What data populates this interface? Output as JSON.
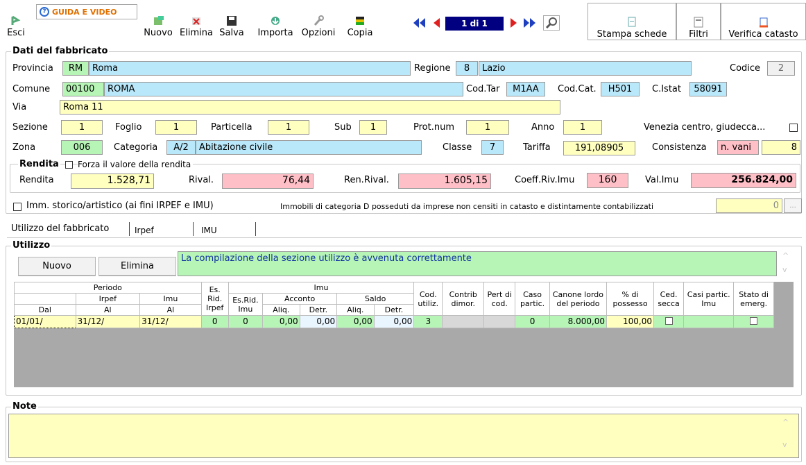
{
  "toolbar": {
    "exit": "Esci",
    "guide": "GUIDA E VIDEO",
    "new": "Nuovo",
    "delete": "Elimina",
    "save": "Salva",
    "import": "Importa",
    "options": "Opzioni",
    "copy": "Copia",
    "record_nav": "1 di 1",
    "print": "Stampa schede",
    "filters": "Filtri",
    "verify": "Verifica catasto"
  },
  "section_title": "Dati del fabbricato",
  "fields": {
    "provincia_label": "Provincia",
    "provincia_code": "RM",
    "provincia_name": "Roma",
    "regione_label": "Regione",
    "regione_code": "8",
    "regione_name": "Lazio",
    "codice_label": "Codice",
    "codice_value": "2",
    "comune_label": "Comune",
    "comune_cap": "00100",
    "comune_name": "ROMA",
    "codtar_label": "Cod.Tar",
    "codtar_value": "M1AA",
    "codcat_label": "Cod.Cat.",
    "codcat_value": "H501",
    "istat_label": "C.Istat",
    "istat_value": "58091",
    "via_label": "Via",
    "via_value": "Roma 11",
    "sezione_label": "Sezione",
    "sezione_value": "1",
    "foglio_label": "Foglio",
    "foglio_value": "1",
    "particella_label": "Particella",
    "particella_value": "1",
    "sub_label": "Sub",
    "sub_value": "1",
    "protnum_label": "Prot.num",
    "protnum_value": "1",
    "anno_label": "Anno",
    "anno_value": "1",
    "venezia_label": "Venezia centro, giudecca...",
    "zona_label": "Zona",
    "zona_value": "006",
    "categoria_label": "Categoria",
    "categoria_code": "A/2",
    "categoria_desc": "Abitazione civile",
    "classe_label": "Classe",
    "classe_value": "7",
    "tariffa_label": "Tariffa",
    "tariffa_value": "191,08905",
    "consistenza_label": "Consistenza",
    "consistenza_unit": "n. vani",
    "consistenza_value": "8"
  },
  "rendita": {
    "title": "Rendita",
    "force_label": "Forza il valore della rendita",
    "rendita_label": "Rendita",
    "rendita_value": "1.528,71",
    "rival_label": "Rival.",
    "rival_value": "76,44",
    "renrival_label": "Ren.Rival.",
    "renrival_value": "1.605,15",
    "coeff_label": "Coeff.Riv.Imu",
    "coeff_value": "160",
    "valimu_label": "Val.Imu",
    "valimu_value": "256.824,00"
  },
  "storico_label": "Imm. storico/artistico (ai fini IRPEF e IMU)",
  "categoria_d_label": "Immobili di categoria D posseduti da imprese non censiti in catasto e distintamente contabilizzati",
  "categoria_d_value": "0",
  "ellipsis": "...",
  "tabs": [
    "Utilizzo del fabbricato",
    "Irpef",
    "IMU"
  ],
  "utilizzo": {
    "title": "Utilizzo",
    "new_btn": "Nuovo",
    "delete_btn": "Elimina",
    "message": "La compilazione della sezione utilizzo è avvenuta correttamente"
  },
  "table": {
    "h_periodo": "Periodo",
    "h_irpef": "Irpef",
    "h_imu": "Imu",
    "h_dal": "Dal",
    "h_al": "Al",
    "h_al2": "Al",
    "h_esrid": "Es. Rid. Irpef",
    "h_imu_top": "Imu",
    "h_esrid_imu": "Es.Rid. Imu",
    "h_acconto": "Acconto",
    "h_saldo": "Saldo",
    "h_aliq": "Aliq.",
    "h_detr": "Detr.",
    "h_aliq2": "Aliq.",
    "h_detr2": "Detr.",
    "h_cod": "Cod. utiliz.",
    "h_contrib": "Contrib dimor.",
    "h_pert": "Pert di cod.",
    "h_caso": "Caso partic.",
    "h_canone": "Canone lordo del periodo",
    "h_possesso": "% di possesso",
    "h_ced": "Ced. secca",
    "h_casi": "Casi partic. Imu",
    "h_stato": "Stato di emerg.",
    "row": {
      "dal": "01/01/",
      "al_irpef": "31/12/",
      "al_imu": "31/12/",
      "es_irpef": "0",
      "es_imu": "0",
      "acc_aliq": "0,00",
      "acc_detr": "0,00",
      "saldo_aliq": "0,00",
      "saldo_detr": "0,00",
      "cod": "3",
      "caso": "0",
      "canone": "8.000,00",
      "possesso": "100,00"
    }
  },
  "note_title": "Note",
  "colors": {
    "yellow": "#ffffc0",
    "green": "#b6f5b6",
    "blue": "#b9e8fa",
    "pink": "#ffbfc7",
    "nav": "#000080"
  }
}
